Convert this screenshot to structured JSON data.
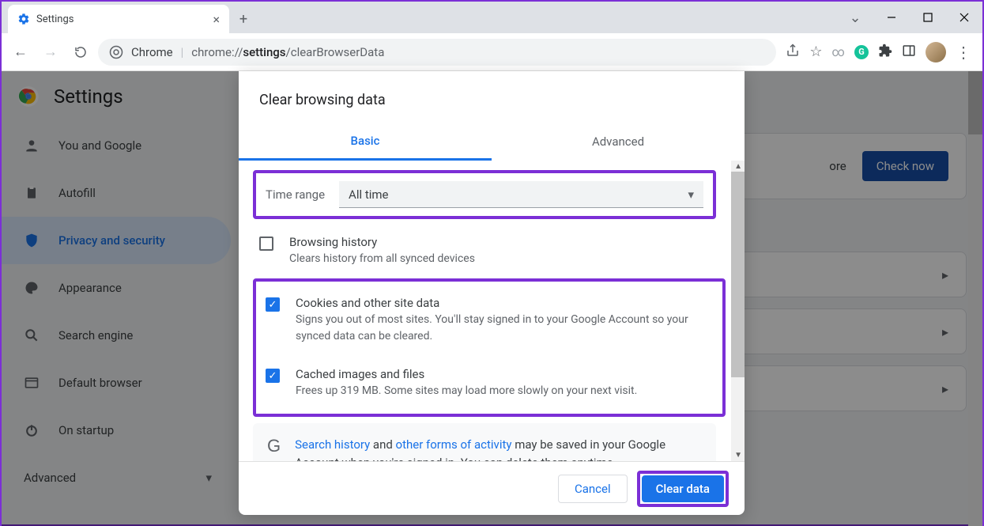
{
  "window": {
    "tab_title": "Settings"
  },
  "omnibox": {
    "scheme_label": "Chrome",
    "url_prefix": "chrome://",
    "url_bold": "settings",
    "url_rest": "/clearBrowserData"
  },
  "page": {
    "title": "Settings",
    "sidebar": [
      {
        "label": "You and Google"
      },
      {
        "label": "Autofill"
      },
      {
        "label": "Privacy and security"
      },
      {
        "label": "Appearance"
      },
      {
        "label": "Search engine"
      },
      {
        "label": "Default browser"
      },
      {
        "label": "On startup"
      }
    ],
    "advanced_label": "Advanced",
    "safety_check": {
      "more_label": "ore",
      "button": "Check now"
    }
  },
  "modal": {
    "title": "Clear browsing data",
    "tabs": {
      "basic": "Basic",
      "advanced": "Advanced"
    },
    "time_range": {
      "label": "Time range",
      "value": "All time"
    },
    "items": [
      {
        "checked": false,
        "title": "Browsing history",
        "desc": "Clears history from all synced devices"
      },
      {
        "checked": true,
        "title": "Cookies and other site data",
        "desc": "Signs you out of most sites. You'll stay signed in to your Google Account so your synced data can be cleared."
      },
      {
        "checked": true,
        "title": "Cached images and files",
        "desc": "Frees up 319 MB. Some sites may load more slowly on your next visit."
      }
    ],
    "info": {
      "link1": "Search history",
      "mid1": " and ",
      "link2": "other forms of activity",
      "rest": " may be saved in your Google Account when you're signed in. You can delete them anytime."
    },
    "buttons": {
      "cancel": "Cancel",
      "clear": "Clear data"
    }
  }
}
